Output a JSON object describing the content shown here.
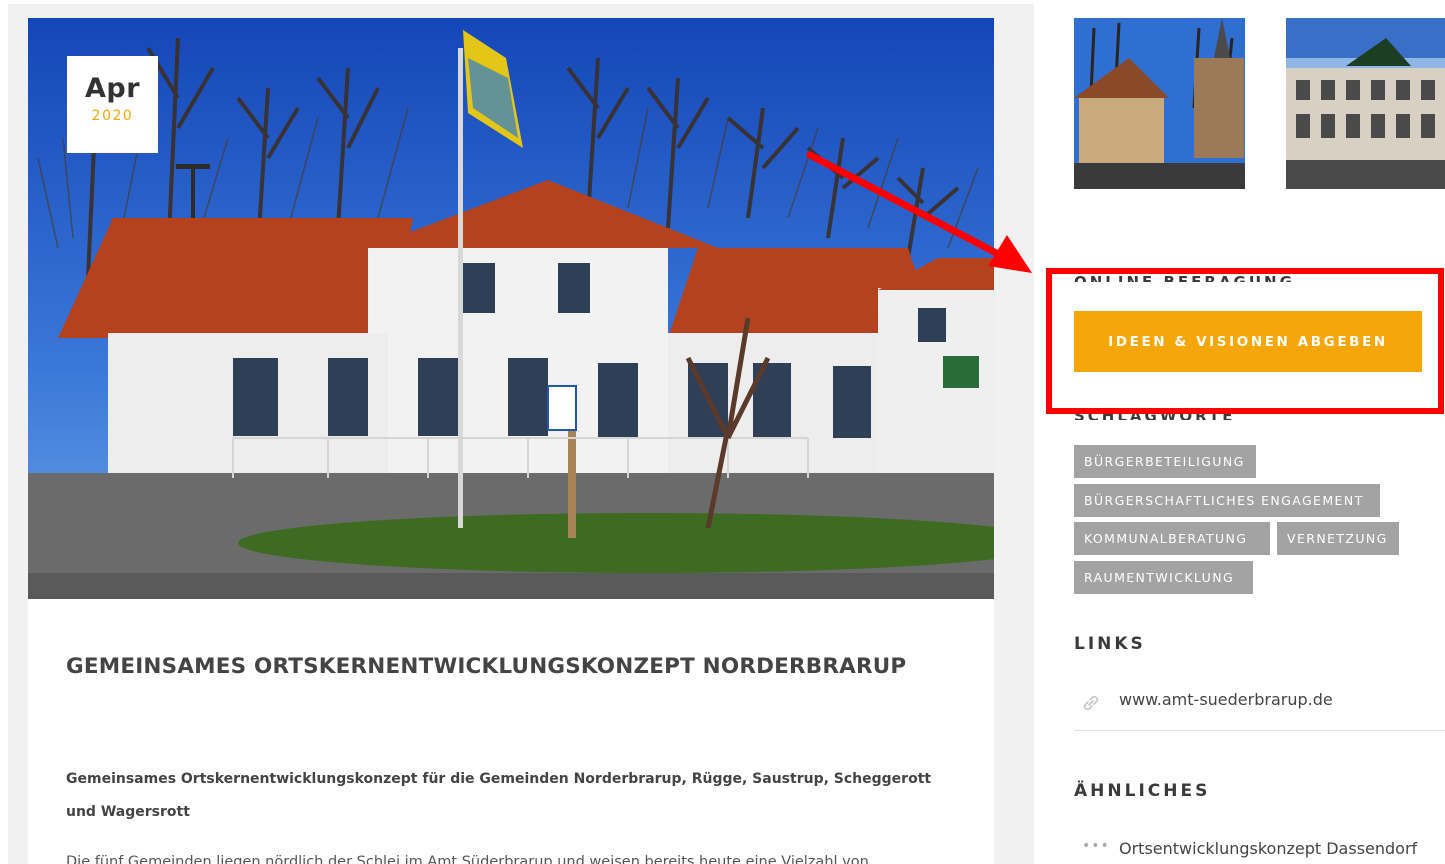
{
  "article": {
    "date_month": "Apr",
    "date_year": "2020",
    "title": "GEMEINSAMES ORTSKERNENTWICKLUNGSKONZEPT NORDERBRARUP",
    "lead": "Gemeinsames Ortskernentwicklungskonzept für die Gemeinden Norderbrarup, Rügge, Saustrup, Scheggerott und Wagersrott",
    "body": "Die fünf Gemeinden liegen nördlich der Schlei im Amt Süderbrarup und weisen bereits heute eine Vielzahl von"
  },
  "sidebar": {
    "online_heading": "ONLINE BEFRAGUNG",
    "cta_label": "IDEEN & VISIONEN ABGEBEN",
    "tags_heading": "SCHLAGWORTE",
    "tags": [
      "BÜRGERBETEILIGUNG",
      "BÜRGERSCHAFTLICHES ENGAGEMENT",
      "KOMMUNALBERATUNG",
      "VERNETZUNG",
      "RAUMENTWICKLUNG"
    ],
    "links_heading": "LINKS",
    "links": [
      {
        "label": "www.amt-suederbrarup.de",
        "icon": "link-icon"
      }
    ],
    "related_heading": "ÄHNLICHES",
    "related": [
      {
        "label": "Ortsentwicklungskonzept Dassendorf",
        "icon": "dots-icon"
      }
    ]
  },
  "colors": {
    "accent": "#f5a60a",
    "tag_bg": "#a3a3a3",
    "annotation": "#ff0000",
    "heading": "#3a3a3a"
  }
}
